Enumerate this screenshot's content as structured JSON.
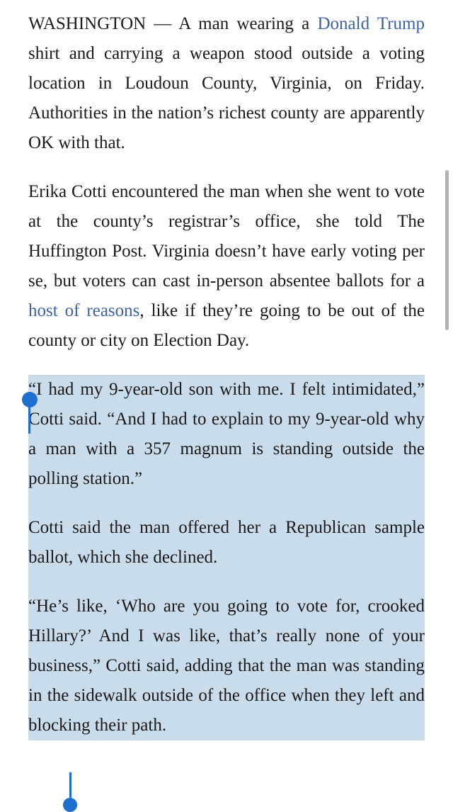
{
  "article": {
    "p1": {
      "before_link": "WASHINGTON — A man wearing a ",
      "link": "Donald Trump",
      "after_link": " shirt and carrying a weapon stood outside a voting location in Loudoun County, Virginia, on Friday. Authorities in the nation’s richest county are apparently OK with that."
    },
    "p2": {
      "before_link": "Erika Cotti encountered the man when she went to vote at the county’s registrar’s office, she told The Huffington Post. Virginia doesn’t have early voting per se, but voters can cast in-person absentee ballots for a ",
      "link": "host of reasons",
      "after_link": ", like if they’re going to be out of the county or city on Election Day."
    },
    "p3": "“I had my 9-year-old son with me. I felt intimidated,” Cotti said. “And I had to explain to my 9-year-old why a man with a 357 magnum is standing outside the polling station.”",
    "p4": "Cotti said the man offered her a Republican sample ballot, which she declined.",
    "p5": "“He’s like, ‘Who are you going to vote for, crooked Hillary?’ And I was like, that’s really none of your business,” Cotti said, adding that the man was standing in the sidewalk outside of the office when they left and blocking their path."
  },
  "colors": {
    "link": "#3b62a8",
    "selection": "#c9dcec",
    "handle": "#1f6fd1",
    "text": "#1a1a1a",
    "scrollbar": "#b3b3b3"
  }
}
